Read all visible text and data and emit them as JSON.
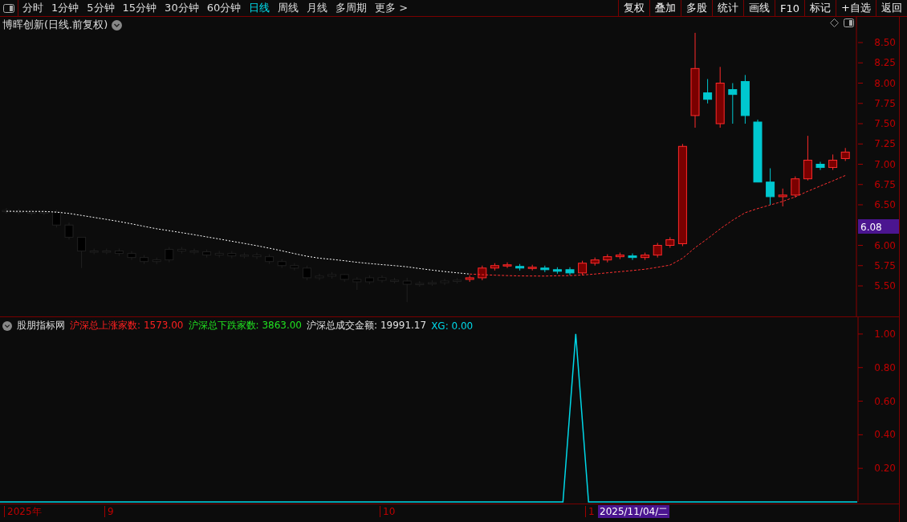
{
  "toolbar": {
    "periods": [
      {
        "label": "分时",
        "selected": false
      },
      {
        "label": "1分钟",
        "selected": false
      },
      {
        "label": "5分钟",
        "selected": false
      },
      {
        "label": "15分钟",
        "selected": false
      },
      {
        "label": "30分钟",
        "selected": false
      },
      {
        "label": "60分钟",
        "selected": false
      },
      {
        "label": "日线",
        "selected": true
      },
      {
        "label": "周线",
        "selected": false
      },
      {
        "label": "月线",
        "selected": false
      },
      {
        "label": "多周期",
        "selected": false
      },
      {
        "label": "更多 >",
        "selected": false
      }
    ],
    "actions": [
      "复权",
      "叠加",
      "多股",
      "统计",
      "画线",
      "F10",
      "标记",
      "+自选",
      "返回"
    ]
  },
  "main_chart": {
    "title": "博晖创新(日线.前复权)",
    "price_axis": [
      "8.50",
      "8.25",
      "8.00",
      "7.75",
      "7.50",
      "7.25",
      "7.00",
      "6.75",
      "6.50",
      "6.00",
      "5.75",
      "5.50"
    ],
    "last_price": "6.08"
  },
  "indicator": {
    "name": "股朋指标网",
    "readouts": [
      {
        "label": "沪深总上涨家数:",
        "value": "1573.00",
        "color": "#ff2020"
      },
      {
        "label": "沪深总下跌家数:",
        "value": "3863.00",
        "color": "#20e020"
      },
      {
        "label": "沪深总成交金额:",
        "value": "19991.17",
        "color": "#e0e0e0"
      },
      {
        "value": "0.00",
        "color": "#00d8e8"
      }
    ],
    "chart_data": {
      "type": "line",
      "ylim": [
        0,
        1.1
      ],
      "yticks": [
        {
          "value": 0.2,
          "label": "0.20"
        },
        {
          "value": 0.4,
          "label": "0.40"
        },
        {
          "value": 0.6,
          "label": "0.60"
        },
        {
          "value": 0.8,
          "label": "0.80"
        },
        {
          "value": 1,
          "label": "1.00"
        }
      ],
      "series": [
        {
          "name": "XG:",
          "color": "#00d8e8",
          "values": [
            0,
            0,
            0,
            0,
            0,
            0,
            0,
            0,
            0,
            0,
            0,
            0,
            0,
            0,
            0,
            0,
            0,
            0,
            0,
            0,
            0,
            0,
            0,
            0,
            0,
            0,
            0,
            0,
            0,
            0,
            0,
            0,
            0,
            0,
            0,
            0,
            0,
            0,
            0,
            0,
            0,
            0,
            0,
            0,
            0,
            1,
            0,
            0,
            0,
            0,
            0,
            0,
            0,
            0,
            0,
            0,
            0,
            0,
            0,
            0,
            0,
            0,
            0,
            0,
            0,
            0,
            0,
            0
          ]
        }
      ]
    }
  },
  "date_axis": {
    "labels": [
      "2025年",
      "9",
      "10",
      "1"
    ],
    "cursor_date": "2025/11/04/二"
  }
}
